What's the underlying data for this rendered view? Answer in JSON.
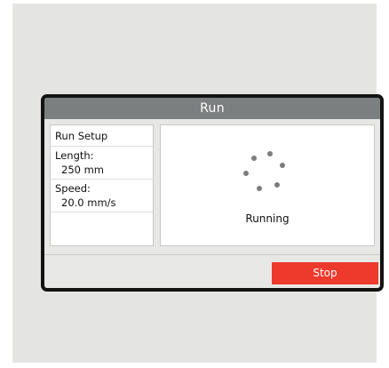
{
  "window": {
    "title": "Run"
  },
  "run_setup": {
    "header": "Run Setup",
    "items": [
      {
        "label": "Length:",
        "value": "250 mm"
      },
      {
        "label": "Speed:",
        "value": "20.0 mm/s"
      }
    ]
  },
  "status": {
    "text": "Running",
    "indicator_icon": "loading-spinner-icon"
  },
  "actions": {
    "stop_label": "Stop"
  },
  "colors": {
    "titlebar": "#7b7f7f",
    "stop_button": "#ee3a2d",
    "spinner_dot": "#7c7c7c",
    "bezel": "#121212"
  }
}
